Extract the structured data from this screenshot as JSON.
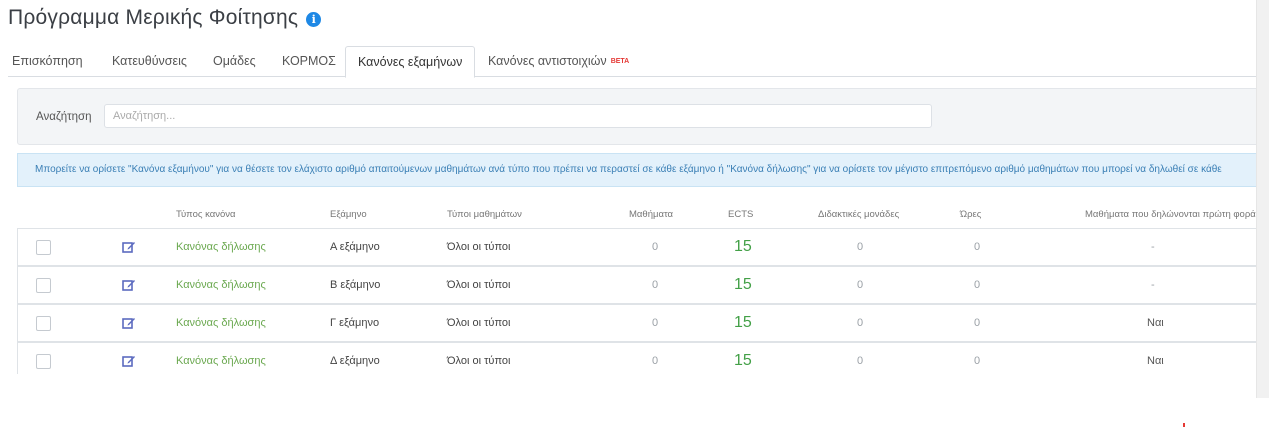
{
  "page": {
    "title": "Πρόγραμμα Μερικής Φοίτησης",
    "info_icon": "info-icon"
  },
  "tabs": [
    {
      "label": "Επισκόπηση",
      "active": false
    },
    {
      "label": "Κατευθύνσεις",
      "active": false
    },
    {
      "label": "Ομάδες",
      "active": false
    },
    {
      "label": "ΚΟΡΜΟΣ",
      "active": false
    },
    {
      "label": "Κανόνες εξαμήνων",
      "active": true
    },
    {
      "label": "Κανόνες αντιστοιχιών",
      "active": false,
      "badge": "BETA"
    }
  ],
  "search": {
    "label": "Αναζήτηση",
    "placeholder": "Αναζήτηση...",
    "value": ""
  },
  "info_message": "Μπορείτε να ορίσετε \"Κανόνα εξαμήνου\" για να θέσετε τον ελάχιστο αριθμό απαιτούμενων μαθημάτων ανά τύπο που πρέπει να περαστεί σε κάθε εξάμηνο ή \"Κανόνα δήλωσης\" για να ορίσετε τον μέγιστο επιτρεπόμενο αριθμό μαθημάτων που μπορεί να δηλωθεί σε κάθε",
  "table": {
    "columns": [
      "Τύπος κανόνα",
      "Εξάμηνο",
      "Τύποι μαθημάτων",
      "Μαθήματα",
      "ECTS",
      "Διδακτικές μονάδες",
      "Ώρες",
      "Μαθήματα που δηλώνονται πρώτη φορά"
    ],
    "rows": [
      {
        "rule_type": "Κανόνας δήλωσης",
        "semester": "Α εξάμηνο",
        "course_types": "Όλοι οι τύποι",
        "courses": "0",
        "ects": "15",
        "units": "0",
        "hours": "0",
        "first_time": "-"
      },
      {
        "rule_type": "Κανόνας δήλωσης",
        "semester": "Β εξάμηνο",
        "course_types": "Όλοι οι τύποι",
        "courses": "0",
        "ects": "15",
        "units": "0",
        "hours": "0",
        "first_time": "-"
      },
      {
        "rule_type": "Κανόνας δήλωσης",
        "semester": "Γ εξάμηνο",
        "course_types": "Όλοι οι τύποι",
        "courses": "0",
        "ects": "15",
        "units": "0",
        "hours": "0",
        "first_time": "Ναι"
      },
      {
        "rule_type": "Κανόνας δήλωσης",
        "semester": "Δ εξάμηνο",
        "course_types": "Όλοι οι τύποι",
        "courses": "0",
        "ects": "15",
        "units": "0",
        "hours": "0",
        "first_time": "Ναι"
      }
    ]
  },
  "colors": {
    "accent": "#1e88e5",
    "rule_link": "#6aa84f",
    "ects": "#43a047",
    "edit_icon": "#5c6bc0",
    "beta": "#e53935",
    "info_bg": "#e3f1fb",
    "info_text": "#3a7fb5"
  }
}
